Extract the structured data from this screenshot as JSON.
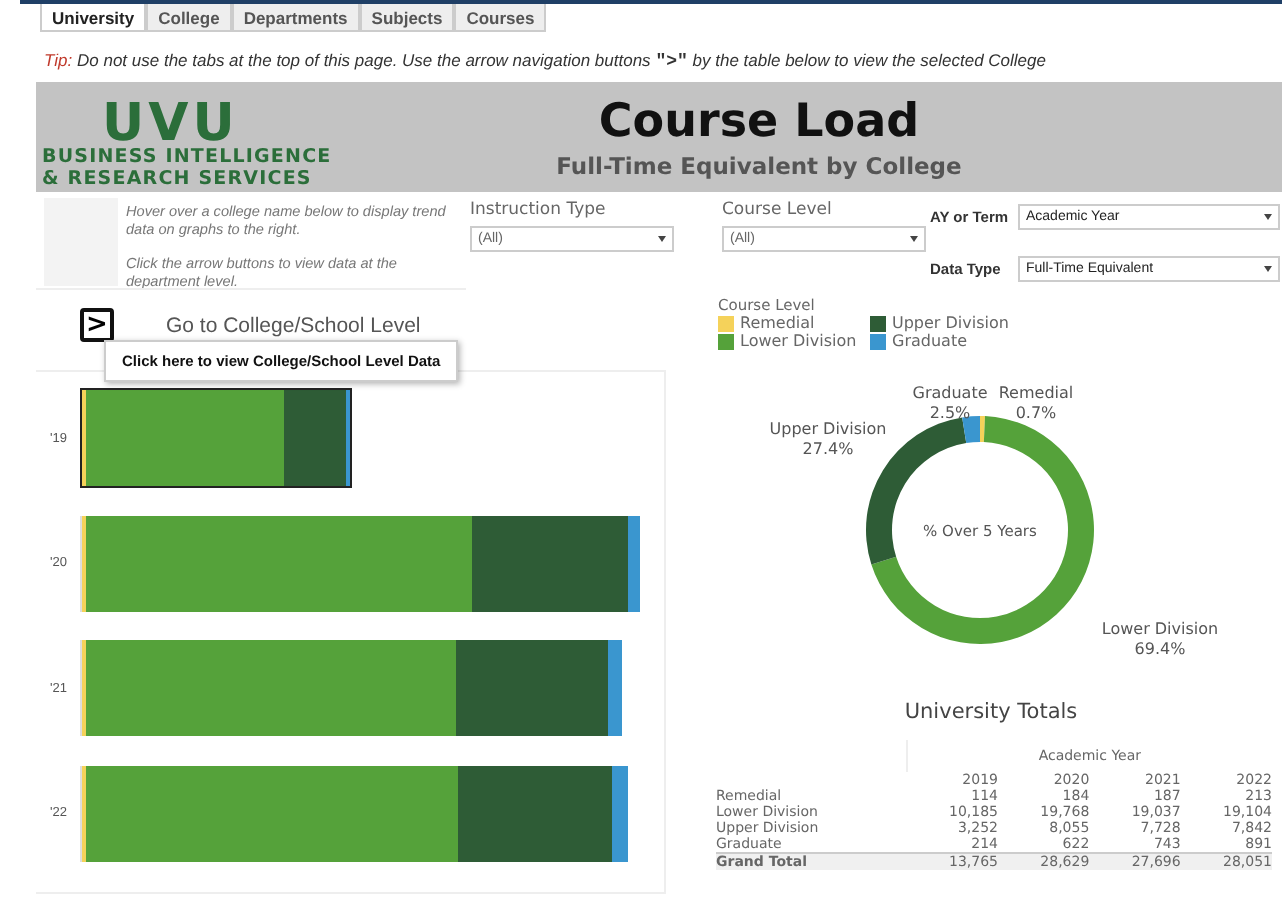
{
  "tabs": [
    {
      "label": "University",
      "selected": true
    },
    {
      "label": "College",
      "selected": false
    },
    {
      "label": "Departments",
      "selected": false
    },
    {
      "label": "Subjects",
      "selected": false
    },
    {
      "label": "Courses",
      "selected": false
    }
  ],
  "tip": {
    "label": "Tip:",
    "text": "Do not use the tabs at the top of this page. Use the arrow navigation buttons",
    "symbol": "\">\"",
    "text_after": "by the table below to view the selected College"
  },
  "banner": {
    "logo": "UVU",
    "logo_lines": [
      "BUSINESS INTELLIGENCE",
      "& RESEARCH SERVICES"
    ],
    "title": "Course Load",
    "subtitle": "Full-Time Equivalent by College"
  },
  "instructions": [
    "Hover over a college name below to display trend data on graphs to the right.",
    "Click the arrow buttons to view data at the department level."
  ],
  "filters": [
    {
      "label": "Instruction Type",
      "value": "(All)",
      "kind": "stacked"
    },
    {
      "label": "Course Level",
      "value": "(All)",
      "kind": "stacked"
    },
    {
      "label": "AY or Term",
      "value": "Academic Year",
      "kind": "inline"
    },
    {
      "label": "Data Type",
      "value": "Full-Time Equivalent",
      "kind": "inline"
    }
  ],
  "navigation": {
    "button": ">",
    "label": "Go to College/School Level",
    "tooltip": "Click here to view College/School Level Data"
  },
  "bar_chart": {
    "bars": [
      {
        "label": "'19",
        "selected": true
      },
      {
        "label": "'20",
        "selected": false
      },
      {
        "label": "'21",
        "selected": false
      },
      {
        "label": "'22",
        "selected": false
      }
    ]
  },
  "legend": {
    "title": "Course Level",
    "items": [
      {
        "label": "Remedial",
        "color": "#f5d25a"
      },
      {
        "label": "Lower Division",
        "color": "#55a23a"
      },
      {
        "label": "Upper Division",
        "color": "#2e5c36"
      },
      {
        "label": "Graduate",
        "color": "#3a96cf"
      }
    ]
  },
  "donut": {
    "chart_data": {
      "type": "donut",
      "title": "% Over 5 Years",
      "categories": [
        "Remedial",
        "Lower Division",
        "Upper Division",
        "Graduate"
      ],
      "values": [
        0.7,
        69.4,
        27.4,
        2.5
      ],
      "value_labels": [
        "0.7%",
        "69.4%",
        "27.4%",
        "2.5%"
      ]
    }
  },
  "totals": {
    "title": "University Totals",
    "group_header": "Academic Year",
    "columns": [
      "2019",
      "2020",
      "2021",
      "2022"
    ],
    "rows": [
      {
        "label": "Remedial",
        "values": [
          "114",
          "184",
          "187",
          "213"
        ]
      },
      {
        "label": "Lower Division",
        "values": [
          "10,185",
          "19,768",
          "19,037",
          "19,104"
        ]
      },
      {
        "label": "Upper Division",
        "values": [
          "3,252",
          "8,055",
          "7,728",
          "7,842"
        ]
      },
      {
        "label": "Graduate",
        "values": [
          "214",
          "622",
          "743",
          "891"
        ]
      }
    ],
    "total": {
      "label": "Grand Total",
      "values": [
        "13,765",
        "28,629",
        "27,696",
        "28,051"
      ]
    }
  }
}
